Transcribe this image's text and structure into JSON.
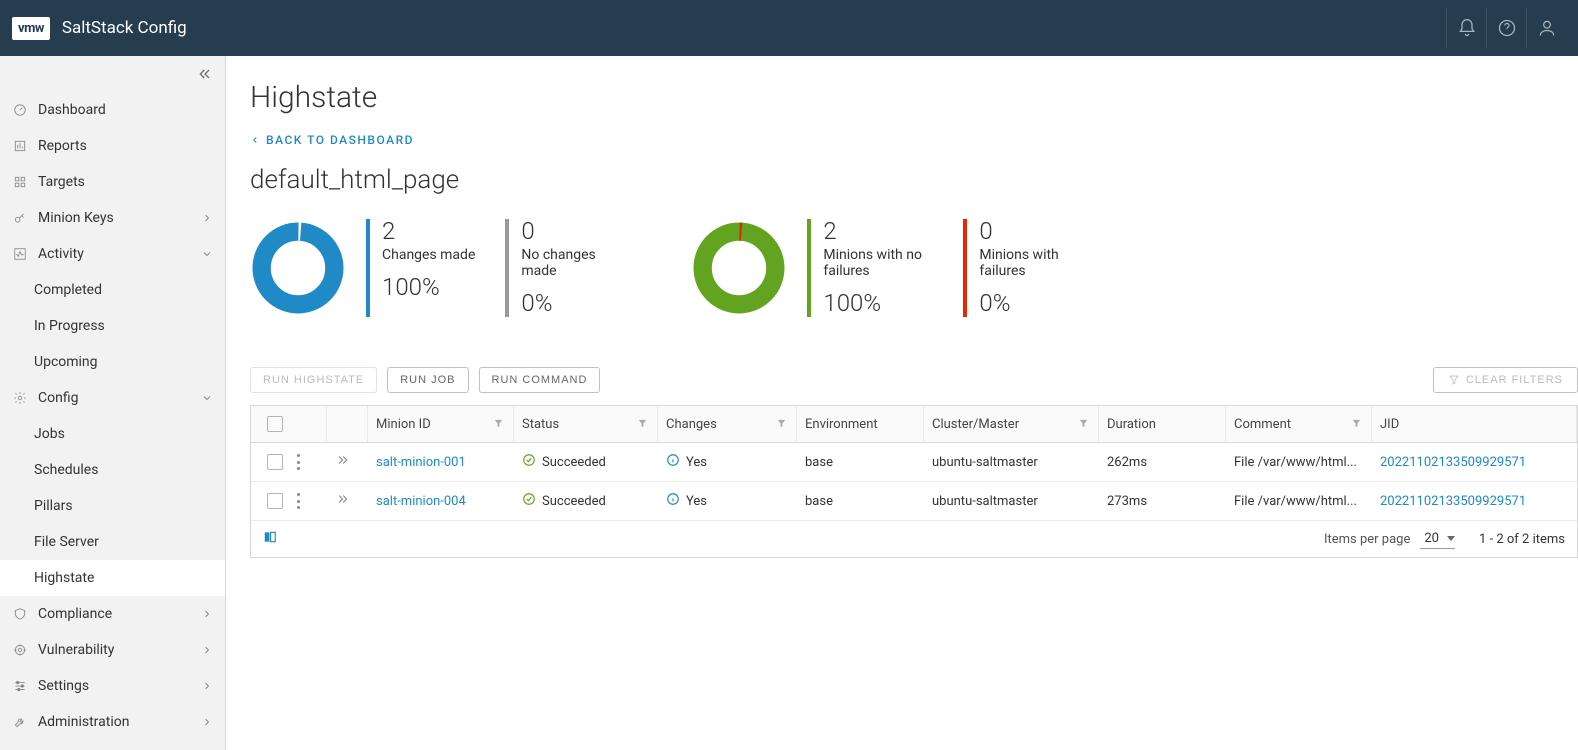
{
  "app": {
    "title": "SaltStack Config",
    "logo": "vmw"
  },
  "sidebar": {
    "items": [
      {
        "label": "Dashboard",
        "icon": "gauge"
      },
      {
        "label": "Reports",
        "icon": "reports"
      },
      {
        "label": "Targets",
        "icon": "grid"
      },
      {
        "label": "Minion Keys",
        "icon": "key",
        "chev": "right"
      },
      {
        "label": "Activity",
        "icon": "activity",
        "chev": "down",
        "children": [
          {
            "label": "Completed"
          },
          {
            "label": "In Progress"
          },
          {
            "label": "Upcoming"
          }
        ]
      },
      {
        "label": "Config",
        "icon": "gear",
        "chev": "down",
        "children": [
          {
            "label": "Jobs"
          },
          {
            "label": "Schedules"
          },
          {
            "label": "Pillars"
          },
          {
            "label": "File Server"
          },
          {
            "label": "Highstate",
            "active": true
          }
        ]
      },
      {
        "label": "Compliance",
        "icon": "shield",
        "chev": "right"
      },
      {
        "label": "Vulnerability",
        "icon": "target",
        "chev": "right"
      },
      {
        "label": "Settings",
        "icon": "sliders",
        "chev": "right"
      },
      {
        "label": "Administration",
        "icon": "wrench",
        "chev": "right"
      }
    ]
  },
  "page": {
    "title": "Highstate",
    "back": "BACK TO DASHBOARD",
    "subtitle": "default_html_page"
  },
  "stats": {
    "changes_made": {
      "count": "2",
      "label": "Changes made",
      "percent": "100%"
    },
    "no_changes": {
      "count": "0",
      "label": "No changes made",
      "percent": "0%"
    },
    "minions_ok": {
      "count": "2",
      "label": "Minions with no failures",
      "percent": "100%"
    },
    "minions_fail": {
      "count": "0",
      "label": "Minions with failures",
      "percent": "0%"
    }
  },
  "chart_data": [
    {
      "type": "pie",
      "title": "Changes",
      "series": [
        {
          "name": "Changes made",
          "value": 2,
          "percent": 100,
          "color": "#1f8ac6"
        },
        {
          "name": "No changes made",
          "value": 0,
          "percent": 0,
          "color": "#9a9a9a"
        }
      ]
    },
    {
      "type": "pie",
      "title": "Minion failures",
      "series": [
        {
          "name": "Minions with no failures",
          "value": 2,
          "percent": 100,
          "color": "#62a420"
        },
        {
          "name": "Minions with failures",
          "value": 0,
          "percent": 0,
          "color": "#e62700"
        }
      ]
    }
  ],
  "actions": {
    "run_highstate": "RUN HIGHSTATE",
    "run_job": "RUN JOB",
    "run_command": "RUN COMMAND",
    "clear_filters": "CLEAR FILTERS"
  },
  "table": {
    "columns": {
      "minion": "Minion ID",
      "status": "Status",
      "changes": "Changes",
      "env": "Environment",
      "cluster": "Cluster/Master",
      "duration": "Duration",
      "comment": "Comment",
      "jid": "JID"
    },
    "rows": [
      {
        "minion": "salt-minion-001",
        "status": "Succeeded",
        "changes": "Yes",
        "env": "base",
        "cluster": "ubuntu-saltmaster",
        "duration": "262ms",
        "comment": "File /var/www/html...",
        "jid": "20221102133509929571"
      },
      {
        "minion": "salt-minion-004",
        "status": "Succeeded",
        "changes": "Yes",
        "env": "base",
        "cluster": "ubuntu-saltmaster",
        "duration": "273ms",
        "comment": "File /var/www/html...",
        "jid": "20221102133509929571"
      }
    ],
    "footer": {
      "per_page_label": "Items per page",
      "per_page_value": "20",
      "range": "1 - 2 of 2 items"
    }
  }
}
